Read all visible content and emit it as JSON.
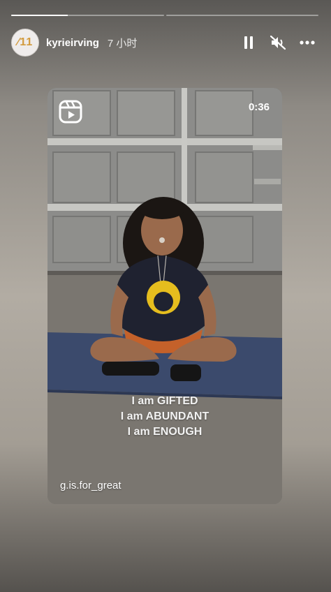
{
  "story": {
    "progress": [
      0.37,
      0.0
    ],
    "avatar_text": "⁄11",
    "username": "kyrieirving",
    "time": "7 小时"
  },
  "controls": {
    "pause_icon": "pause-icon",
    "mute_icon": "speaker-muted-icon",
    "more_icon": "more-icon"
  },
  "media": {
    "type_icon": "reels-icon",
    "duration": "0:36",
    "caption_lines": [
      "I am GIFTED",
      "I am ABUNDANT",
      "I am ENOUGH"
    ],
    "source": "g.is.for_great"
  },
  "colors": {
    "avatar_text": "#d29a3c",
    "mat": "#3b4a6c",
    "shirt_logo": "#e5bd1e"
  }
}
